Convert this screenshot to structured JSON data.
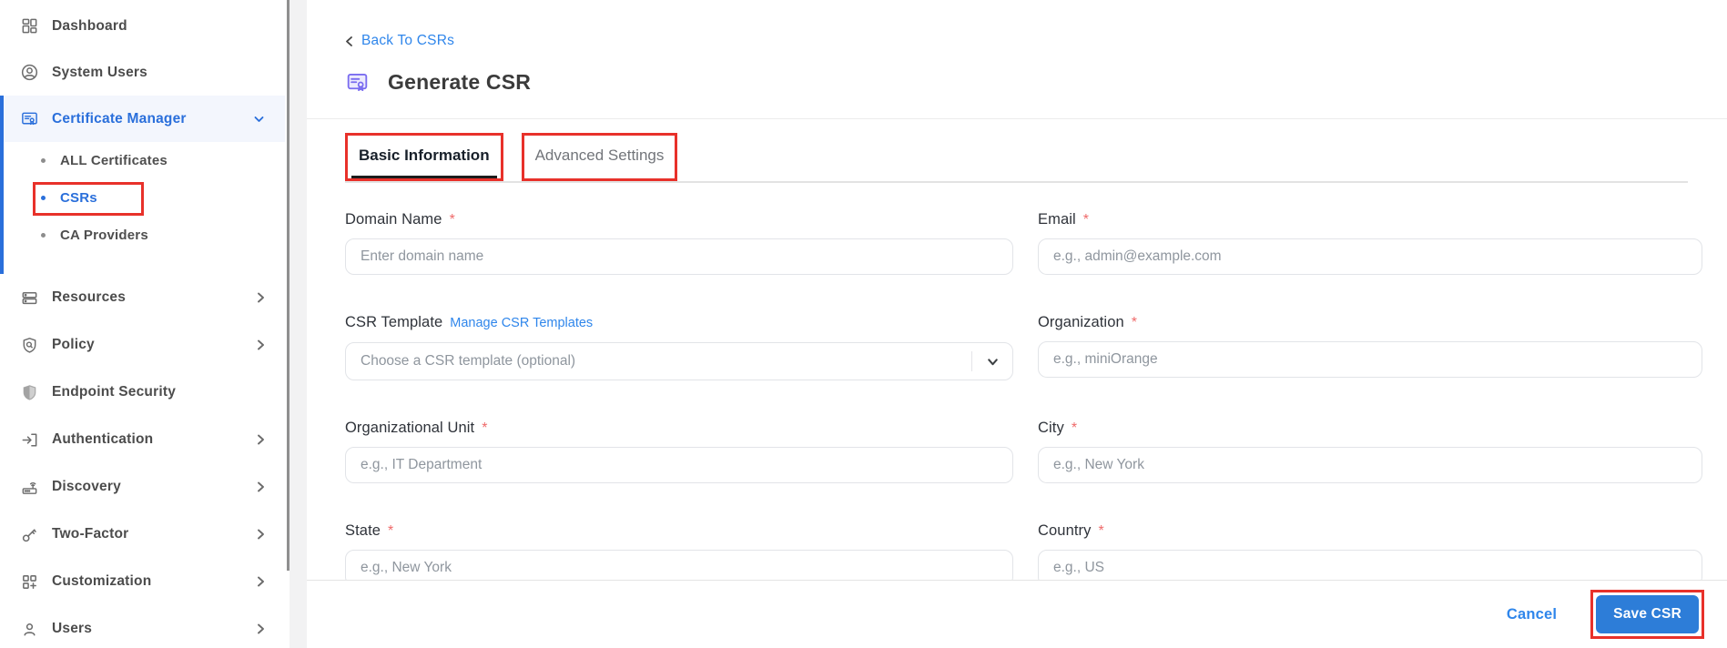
{
  "colors": {
    "accent_link_blue": "#2f86eb",
    "sidebar_active_blue": "#2a6fdb",
    "save_button_blue": "#2d7dd8",
    "annotation_red": "#e8312a",
    "title_icon_purple": "#7a6cf0"
  },
  "sidebar": {
    "items": [
      {
        "label": "Dashboard",
        "icon": "dashboard-icon"
      },
      {
        "label": "System Users",
        "icon": "user-circle-icon"
      },
      {
        "label": "Certificate Manager",
        "icon": "certificate-icon",
        "active": true,
        "expanded": true
      },
      {
        "label": "Resources",
        "icon": "resources-icon"
      },
      {
        "label": "Policy",
        "icon": "policy-shield-icon"
      },
      {
        "label": "Endpoint Security",
        "icon": "endpoint-shield-icon"
      },
      {
        "label": "Authentication",
        "icon": "login-arrow-icon"
      },
      {
        "label": "Discovery",
        "icon": "router-icon"
      },
      {
        "label": "Two-Factor",
        "icon": "key-icon"
      },
      {
        "label": "Customization",
        "icon": "grid-plus-icon"
      },
      {
        "label": "Users",
        "icon": "person-icon"
      }
    ],
    "certificate_submenu": [
      {
        "label": "ALL Certificates",
        "active": false
      },
      {
        "label": "CSRs",
        "active": true,
        "annotated": true
      },
      {
        "label": "CA Providers",
        "active": false
      }
    ]
  },
  "header": {
    "back_link": "Back To CSRs",
    "title": "Generate CSR"
  },
  "tabs": [
    {
      "label": "Basic Information",
      "active": true
    },
    {
      "label": "Advanced Settings",
      "active": false
    }
  ],
  "form": {
    "required_marker": "*",
    "fields": [
      {
        "label": "Domain Name",
        "required": true,
        "placeholder": "Enter domain name"
      },
      {
        "label": "Email",
        "required": true,
        "placeholder": "e.g., admin@example.com"
      },
      {
        "label": "CSR Template",
        "required": false,
        "link": "Manage CSR Templates",
        "placeholder": "Choose a CSR template (optional)",
        "type": "select"
      },
      {
        "label": "Organization",
        "required": true,
        "placeholder": "e.g., miniOrange"
      },
      {
        "label": "Organizational Unit",
        "required": true,
        "placeholder": "e.g., IT Department"
      },
      {
        "label": "City",
        "required": true,
        "placeholder": "e.g., New York"
      },
      {
        "label": "State",
        "required": true,
        "placeholder": "e.g., New York"
      },
      {
        "label": "Country",
        "required": true,
        "placeholder": "e.g., US"
      }
    ]
  },
  "footer": {
    "cancel_label": "Cancel",
    "save_label": "Save CSR"
  }
}
